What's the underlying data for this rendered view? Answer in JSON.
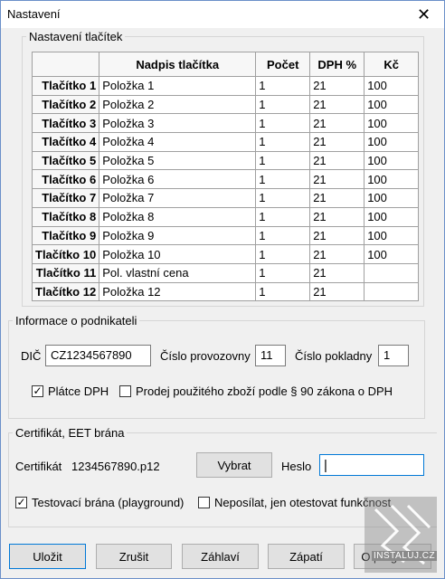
{
  "window": {
    "title": "Nastavení",
    "close_glyph": "✕"
  },
  "buttons_group": {
    "legend": "Nastavení tlačítek",
    "columns": [
      "",
      "Nadpis tlačítka",
      "Počet",
      "DPH %",
      "Kč"
    ],
    "rows": [
      {
        "label": "Tlačítko 1",
        "title": "Položka 1",
        "count": "1",
        "vat": "21",
        "price": "100"
      },
      {
        "label": "Tlačítko 2",
        "title": "Položka 2",
        "count": "1",
        "vat": "21",
        "price": "100"
      },
      {
        "label": "Tlačítko 3",
        "title": "Položka 3",
        "count": "1",
        "vat": "21",
        "price": "100"
      },
      {
        "label": "Tlačítko 4",
        "title": "Položka 4",
        "count": "1",
        "vat": "21",
        "price": "100"
      },
      {
        "label": "Tlačítko 5",
        "title": "Položka 5",
        "count": "1",
        "vat": "21",
        "price": "100"
      },
      {
        "label": "Tlačítko 6",
        "title": "Položka 6",
        "count": "1",
        "vat": "21",
        "price": "100"
      },
      {
        "label": "Tlačítko 7",
        "title": "Položka 7",
        "count": "1",
        "vat": "21",
        "price": "100"
      },
      {
        "label": "Tlačítko 8",
        "title": "Položka 8",
        "count": "1",
        "vat": "21",
        "price": "100"
      },
      {
        "label": "Tlačítko 9",
        "title": "Položka 9",
        "count": "1",
        "vat": "21",
        "price": "100"
      },
      {
        "label": "Tlačítko 10",
        "title": "Položka 10",
        "count": "1",
        "vat": "21",
        "price": "100"
      },
      {
        "label": "Tlačítko 11",
        "title": "Pol. vlastní cena",
        "count": "1",
        "vat": "21",
        "price": ""
      },
      {
        "label": "Tlačítko 12",
        "title": "Položka 12",
        "count": "1",
        "vat": "21",
        "price": ""
      }
    ]
  },
  "business": {
    "legend": "Informace o podnikateli",
    "dic_label": "DIČ",
    "dic_value": "CZ1234567890",
    "shop_label": "Číslo provozovny",
    "shop_value": "11",
    "register_label": "Číslo pokladny",
    "register_value": "1",
    "vat_payer_label": "Plátce DPH",
    "vat_payer_checked": true,
    "used_goods_label": "Prodej použitého zboží podle § 90 zákona o DPH",
    "used_goods_checked": false
  },
  "cert": {
    "legend": "Certifikát, EET brána",
    "cert_label": "Certifikát",
    "cert_value": "1234567890.p12",
    "choose_label": "Vybrat",
    "password_label": "Heslo",
    "password_value": "",
    "test_gateway_label": "Testovací brána (playground)",
    "test_gateway_checked": true,
    "no_send_label": "Neposílat, jen otestovat funkčnost",
    "no_send_checked": false
  },
  "footer": {
    "save": "Uložit",
    "cancel": "Zrušit",
    "header": "Záhlaví",
    "footer_btn": "Zápatí",
    "about": "O programu"
  },
  "watermark": {
    "text": "INSTALUJ.CZ"
  },
  "check_glyph": "✓"
}
